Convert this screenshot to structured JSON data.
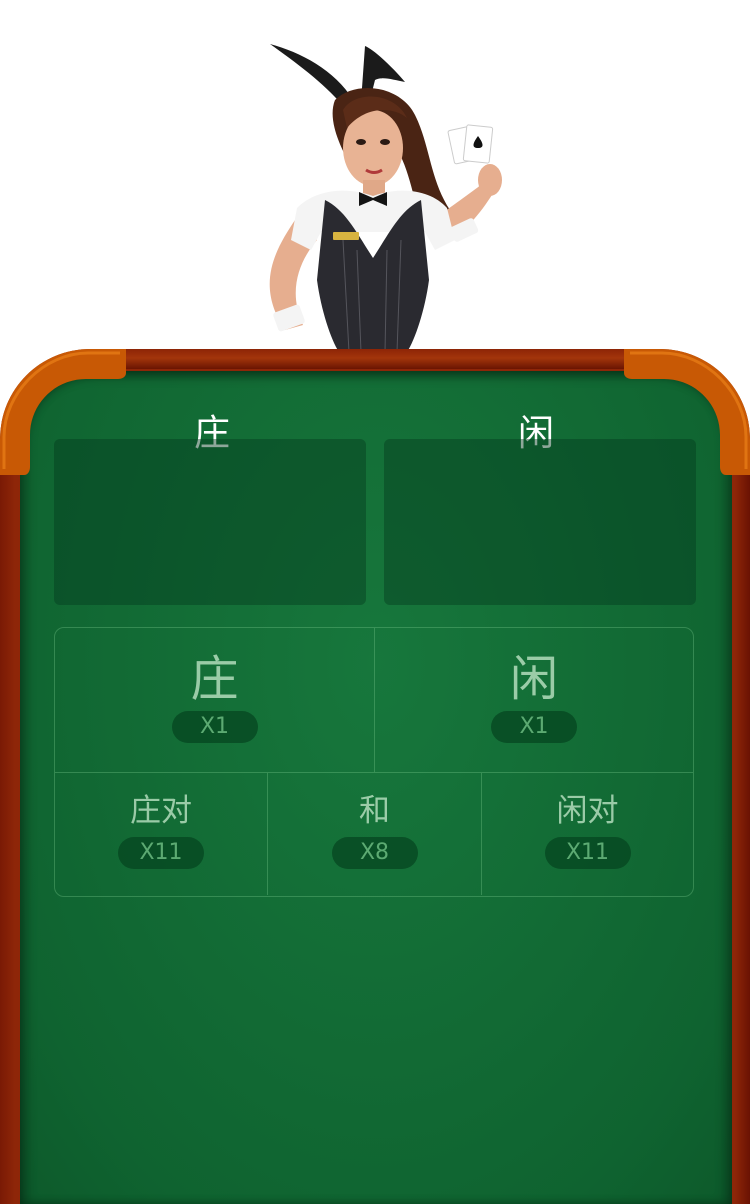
{
  "dealer": {
    "icon": "dealer-girl-illustration"
  },
  "table": {
    "felt_color": "#136d36",
    "rail_color": "#8e2608",
    "corner_color": "#c95a05"
  },
  "card_areas": {
    "banker_title": "庄",
    "player_title": "闲"
  },
  "bets": {
    "banker": {
      "label": "庄",
      "odds": "X1"
    },
    "player": {
      "label": "闲",
      "odds": "X1"
    },
    "banker_pair": {
      "label": "庄对",
      "odds": "X11"
    },
    "tie": {
      "label": "和",
      "odds": "X8"
    },
    "player_pair": {
      "label": "闲对",
      "odds": "X11"
    }
  }
}
